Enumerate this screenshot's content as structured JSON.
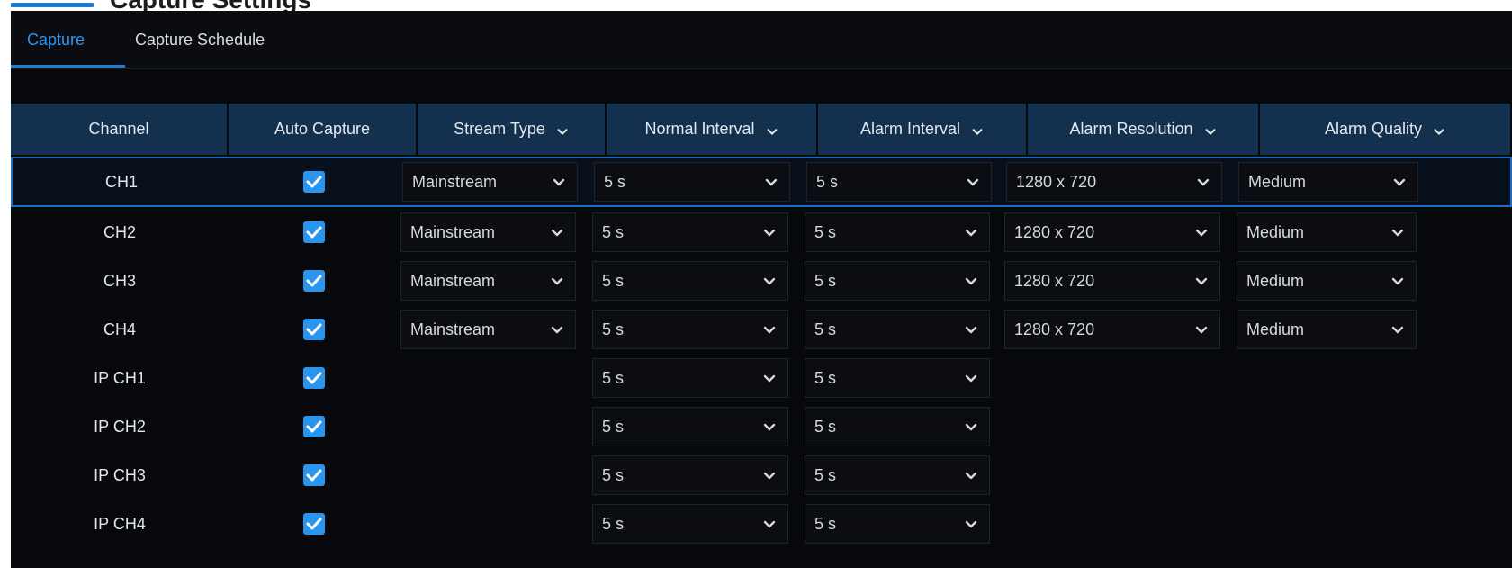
{
  "title": {
    "text": "Capture Settings"
  },
  "tabs": [
    {
      "label": "Capture",
      "active": true
    },
    {
      "label": "Capture Schedule",
      "active": false
    }
  ],
  "columns": [
    {
      "label": "Channel",
      "dropdown": false
    },
    {
      "label": "Auto Capture",
      "dropdown": false
    },
    {
      "label": "Stream Type",
      "dropdown": true
    },
    {
      "label": "Normal Interval",
      "dropdown": true
    },
    {
      "label": "Alarm Interval",
      "dropdown": true
    },
    {
      "label": "Alarm Resolution",
      "dropdown": true
    },
    {
      "label": "Alarm Quality",
      "dropdown": true
    }
  ],
  "rows": [
    {
      "channel": "CH1",
      "auto_capture": true,
      "stream_type": "Mainstream",
      "normal_interval": "5 s",
      "alarm_interval": "5 s",
      "alarm_resolution": "1280 x 720",
      "alarm_quality": "Medium",
      "selected": true
    },
    {
      "channel": "CH2",
      "auto_capture": true,
      "stream_type": "Mainstream",
      "normal_interval": "5 s",
      "alarm_interval": "5 s",
      "alarm_resolution": "1280 x 720",
      "alarm_quality": "Medium"
    },
    {
      "channel": "CH3",
      "auto_capture": true,
      "stream_type": "Mainstream",
      "normal_interval": "5 s",
      "alarm_interval": "5 s",
      "alarm_resolution": "1280 x 720",
      "alarm_quality": "Medium"
    },
    {
      "channel": "CH4",
      "auto_capture": true,
      "stream_type": "Mainstream",
      "normal_interval": "5 s",
      "alarm_interval": "5 s",
      "alarm_resolution": "1280 x 720",
      "alarm_quality": "Medium"
    },
    {
      "channel": "IP CH1",
      "auto_capture": true,
      "normal_interval": "5 s",
      "alarm_interval": "5 s"
    },
    {
      "channel": "IP CH2",
      "auto_capture": true,
      "normal_interval": "5 s",
      "alarm_interval": "5 s"
    },
    {
      "channel": "IP CH3",
      "auto_capture": true,
      "normal_interval": "5 s",
      "alarm_interval": "5 s"
    },
    {
      "channel": "IP CH4",
      "auto_capture": true,
      "normal_interval": "5 s",
      "alarm_interval": "5 s"
    }
  ],
  "colors": {
    "accent": "#2a95ef",
    "header_bg": "#13304f",
    "panel_bg": "#07080c",
    "selected_border": "#1a6fc0"
  },
  "icons": {
    "checkbox": "checkmark-icon",
    "dropdown": "chevron-down-icon"
  }
}
